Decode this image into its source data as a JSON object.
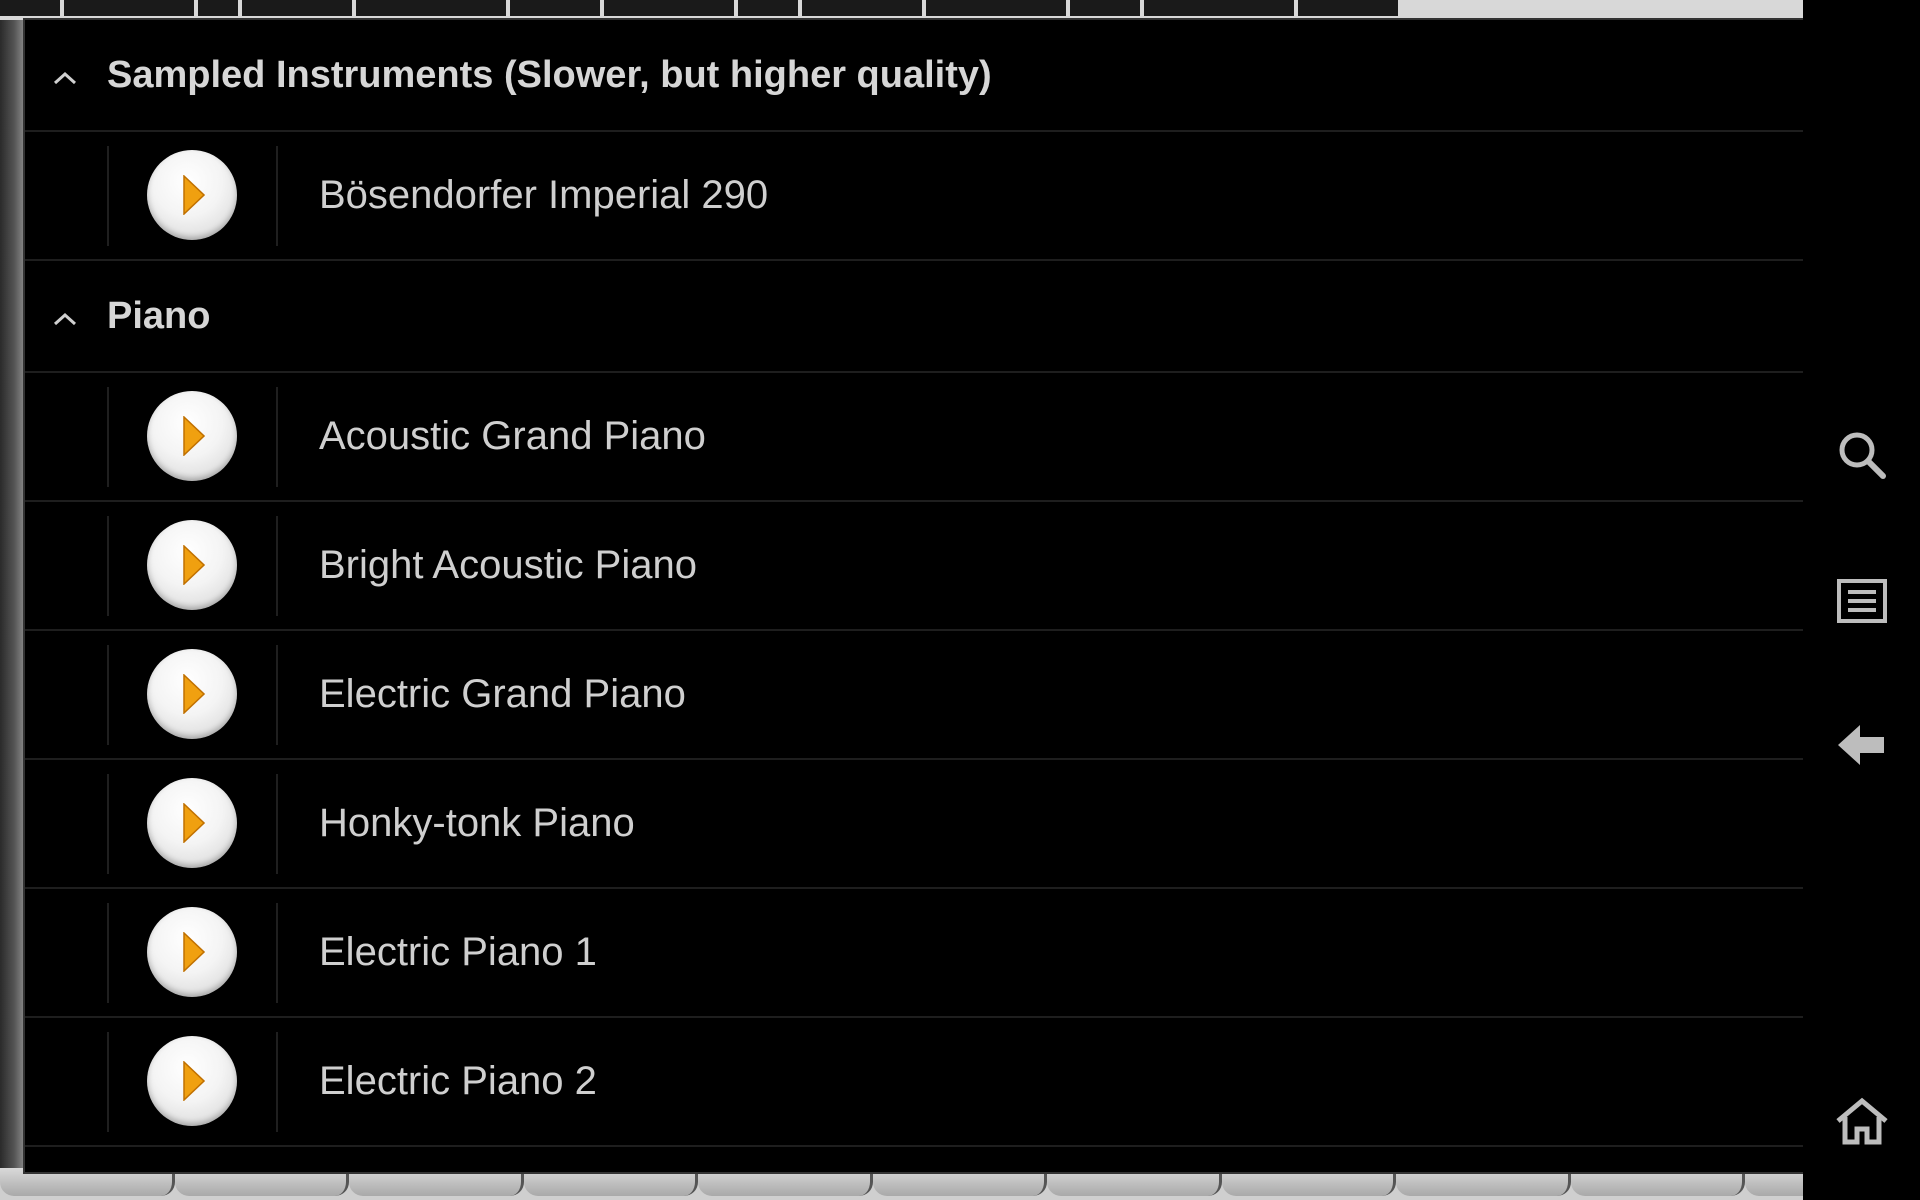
{
  "colors": {
    "accent_play": "#f0a010",
    "text_primary": "#cfcfcf",
    "background": "#000000",
    "divider": "#1e1e1e"
  },
  "groups": [
    {
      "title": "Sampled Instruments (Slower, but higher quality)",
      "expanded": true,
      "items": [
        {
          "label": "Bösendorfer Imperial 290",
          "icon": "play-icon"
        }
      ]
    },
    {
      "title": "Piano",
      "expanded": true,
      "items": [
        {
          "label": "Acoustic Grand Piano",
          "icon": "play-icon"
        },
        {
          "label": "Bright Acoustic Piano",
          "icon": "play-icon"
        },
        {
          "label": "Electric Grand Piano",
          "icon": "play-icon"
        },
        {
          "label": "Honky-tonk Piano",
          "icon": "play-icon"
        },
        {
          "label": "Electric Piano 1",
          "icon": "play-icon"
        },
        {
          "label": "Electric Piano 2",
          "icon": "play-icon"
        }
      ]
    }
  ],
  "navbar": {
    "icons": [
      "search-icon",
      "menu-list-icon",
      "back-arrow-icon",
      "home-icon"
    ]
  }
}
